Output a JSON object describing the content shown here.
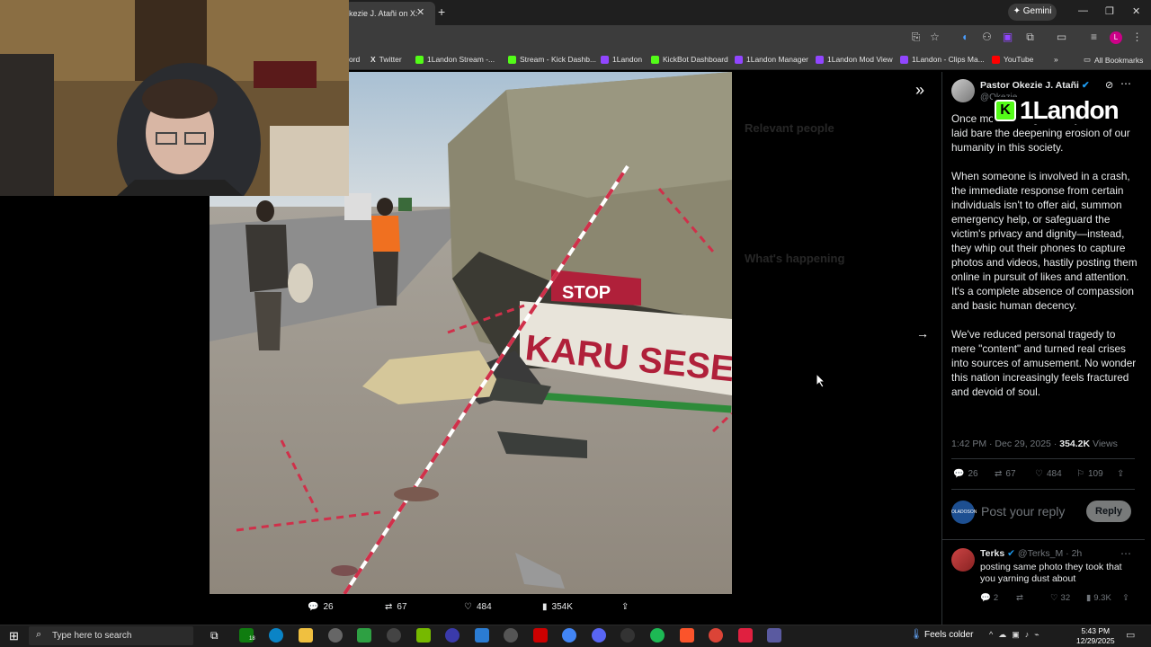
{
  "browser": {
    "active_tab_title": "kezie J. Atañi on X:",
    "gemini_label": "Gemini",
    "bookmarks": [
      {
        "label": "ord",
        "color": "#3c3c3c"
      },
      {
        "label": "Twitter",
        "color": "#000000"
      },
      {
        "label": "1Landon Stream -...",
        "color": "#53fc18"
      },
      {
        "label": "Stream - Kick Dashb...",
        "color": "#53fc18"
      },
      {
        "label": "1Landon",
        "color": "#9146ff"
      },
      {
        "label": "KickBot Dashboard",
        "color": "#53fc18"
      },
      {
        "label": "1Landon Manager",
        "color": "#9146ff"
      },
      {
        "label": "1Landon Mod View",
        "color": "#9146ff"
      },
      {
        "label": "1Landon - Clips Ma...",
        "color": "#9146ff"
      },
      {
        "label": "YouTube",
        "color": "#ff0000"
      }
    ],
    "all_bookmarks_label": "All Bookmarks"
  },
  "overlay": {
    "watermark_letter": "K",
    "watermark_text": "1Landon"
  },
  "media": {
    "truck_text": "KARU SESE",
    "sign_text": "STOP",
    "actions": {
      "replies": "26",
      "reposts": "67",
      "likes": "484",
      "views": "354K"
    }
  },
  "side_panel": {
    "relevant_people": "Relevant people",
    "whats_happening": "What's happening"
  },
  "tweet": {
    "author": "Pastor Okezie J. Atañi",
    "handle": "@Okezie",
    "paragraphs": [
      "Once mo                        involving Anthony Joshua has laid bare the deepening erosion of our humanity in this society.",
      "When someone is involved in a crash, the immediate response from certain individuals isn't to offer aid, summon emergency help, or safeguard the victim's privacy and dignity—instead, they whip out their phones to capture photos and videos, hastily posting them online in pursuit of likes and attention. It's a complete absence of compassion and basic human decency.",
      "We've reduced personal tragedy to mere \"content\" and turned real crises into sources of amusement. No wonder this nation increasingly feels fractured and devoid of soul."
    ],
    "time": "1:42 PM · Dec 29, 2025 · ",
    "views_count": "354.2K",
    "views_label": " Views",
    "actions": {
      "replies": "26",
      "reposts": "67",
      "likes": "484",
      "bookmarks": "109"
    },
    "reply_avatar_text": "OLADOSON",
    "reply_placeholder": "Post your reply",
    "reply_button": "Reply"
  },
  "reply": {
    "name": "Terks",
    "handle": "@Terks_M · 2h",
    "text": "posting same photo they took that you yarning dust about",
    "actions": {
      "replies": "2",
      "likes": "32",
      "views": "9.3K"
    }
  },
  "taskbar": {
    "search_placeholder": "Type here to search",
    "weather": "Feels colder",
    "time": "5:43 PM",
    "date": "12/29/2025",
    "badge": "18"
  }
}
